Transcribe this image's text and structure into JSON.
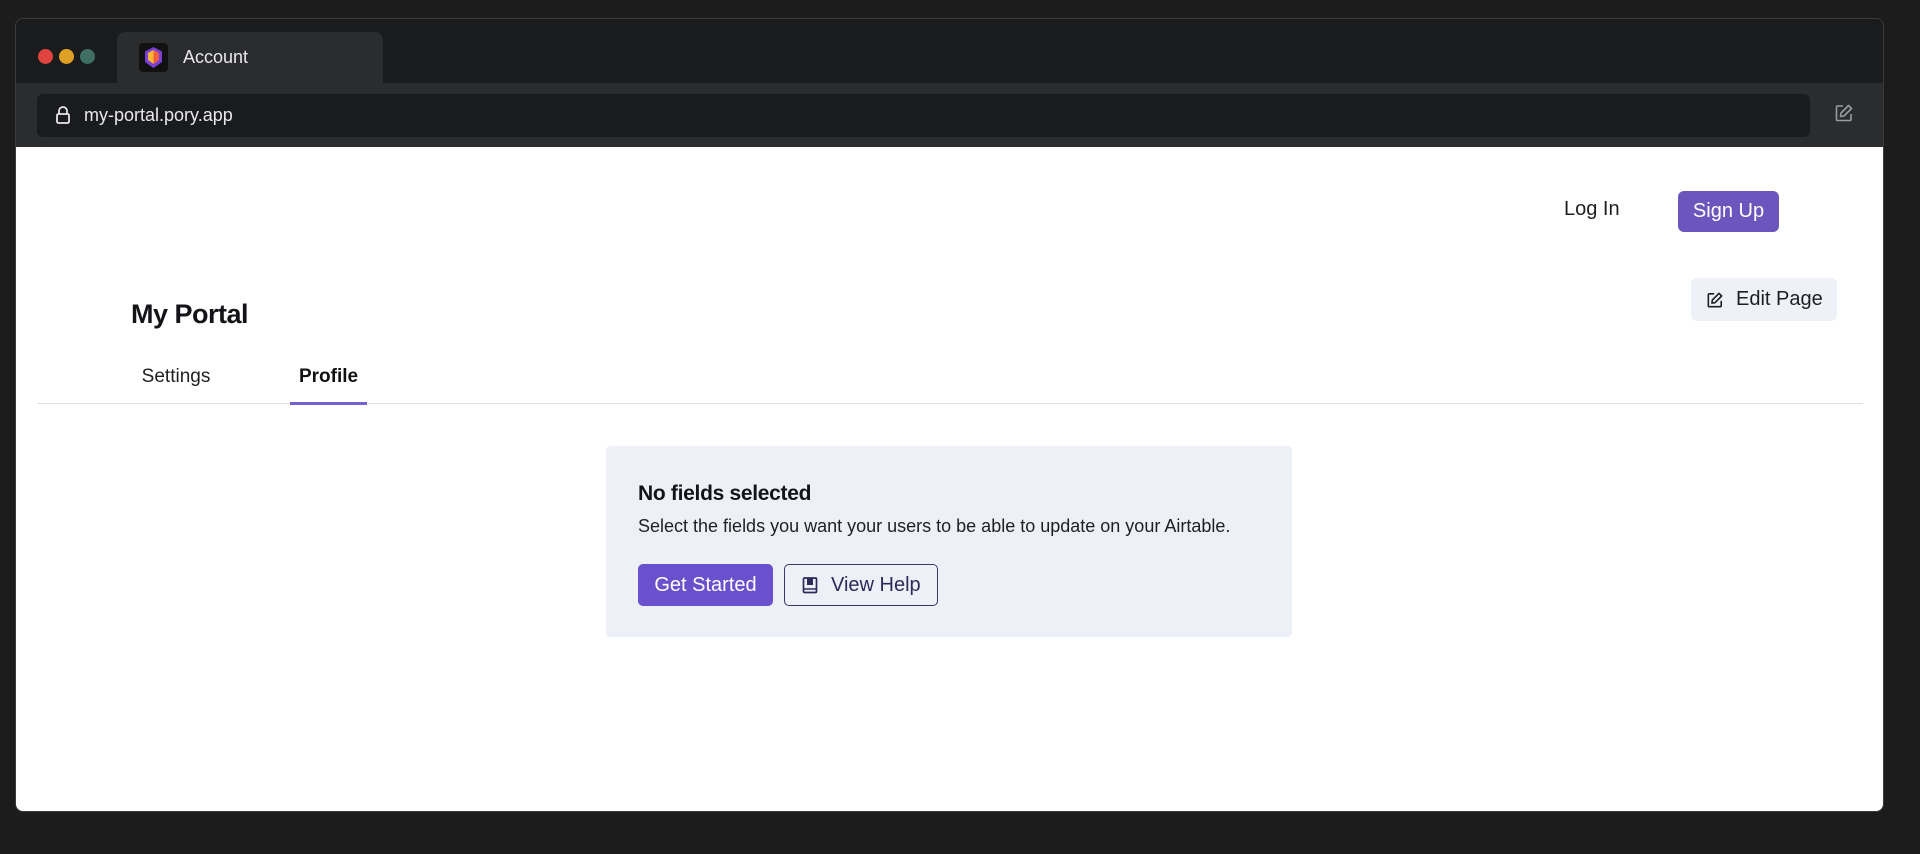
{
  "browser": {
    "tab": {
      "title": "Account",
      "favicon": "pory-logo-icon"
    },
    "address_bar": {
      "url": "my-portal.pory.app",
      "lock_icon": "lock-icon",
      "edit_icon": "edit-icon"
    },
    "window_controls": [
      "close",
      "minimize",
      "maximize"
    ]
  },
  "header": {
    "login_label": "Log In",
    "signup_label": "Sign Up",
    "edit_page_label": "Edit Page"
  },
  "page": {
    "title": "My Portal",
    "tabs": [
      {
        "label": "Settings",
        "active": false
      },
      {
        "label": "Profile",
        "active": true
      }
    ]
  },
  "empty_state": {
    "title": "No fields selected",
    "description": "Select the fields you want your users to be able to update on your Airtable.",
    "primary_label": "Get Started",
    "secondary_label": "View Help",
    "secondary_icon": "book-icon"
  },
  "colors": {
    "accent": "#6c56bd",
    "primary_button": "#6a50cc",
    "tab_underline": "#7562d0",
    "card_bg": "#edf1f7",
    "chrome_dark": "#1a1b1c"
  }
}
